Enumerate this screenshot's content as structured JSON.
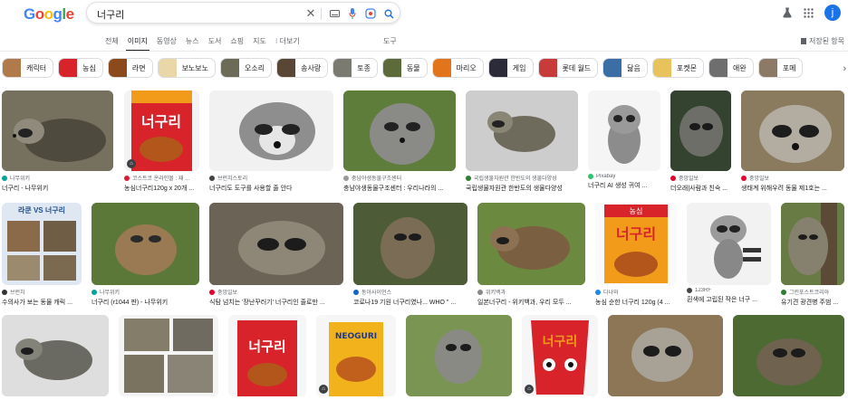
{
  "logo": {
    "text": "Google"
  },
  "search": {
    "query": "너구리"
  },
  "account": {
    "initial": "j"
  },
  "tabs": [
    {
      "label": "전체"
    },
    {
      "label": "이미지"
    },
    {
      "label": "동영상"
    },
    {
      "label": "뉴스"
    },
    {
      "label": "도서"
    },
    {
      "label": "쇼핑"
    },
    {
      "label": "지도"
    },
    {
      "label": "⁝ 더보기"
    }
  ],
  "tools_label": "도구",
  "saved_label": "저장된 항목",
  "chips": [
    {
      "label": "캐릭터"
    },
    {
      "label": "농심"
    },
    {
      "label": "라면"
    },
    {
      "label": "보노보노"
    },
    {
      "label": "오소리"
    },
    {
      "label": "송사랑"
    },
    {
      "label": "토종"
    },
    {
      "label": "동물"
    },
    {
      "label": "마리오"
    },
    {
      "label": "게임"
    },
    {
      "label": "롯데 월드"
    },
    {
      "label": "닮음"
    },
    {
      "label": "포켓몬"
    },
    {
      "label": "애완"
    },
    {
      "label": "포메"
    }
  ],
  "results": [
    {
      "source": "나무위키",
      "title": "너구리 - 나무위키"
    },
    {
      "source": "코스트코 온라인몰 : 재 ...",
      "title": "농심너구리120g x 20개 ..."
    },
    {
      "source": "브런치스토리",
      "title": "너구리도 도구를 사용할 줄 안다"
    },
    {
      "source": "충남야생동물구조센터",
      "title": "충남야생동물구조센터 : 우리나라의 ..."
    },
    {
      "source": "국립생물자원관 한반도의 생물다양성",
      "title": "국립생물자원관 한반도의 생물다양성"
    },
    {
      "source": "Pixabay",
      "title": "너구리 AI 생성 귀여 ..."
    },
    {
      "source": "중앙일보",
      "title": "더오래|사람과 친숙 ..."
    },
    {
      "source": "중앙일보",
      "title": "생태계 위해우려 동물 제1호는 ..."
    },
    {
      "source": "브런치",
      "title": "수의사가 보는 동물 캐릭 ...",
      "banner": "라쿤 VS 너구리"
    },
    {
      "source": "나무위키",
      "title": "너구리 (r1044 판) - 나무위키"
    },
    {
      "source": "중앙일보",
      "title": "식탐 넘치는 '장난꾸러기' 너구리인 줄로만 ..."
    },
    {
      "source": "동아사이언스",
      "title": "코로나19 기원 너구리였나... WHO \" ..."
    },
    {
      "source": "위키백과",
      "title": "일본너구리 - 위키백과, 우리 모두 ..."
    },
    {
      "source": "다나와",
      "title": "농심 순한 너구리 120g (4 ..."
    },
    {
      "source": "123RF",
      "title": "흰색에 고립된 작은 너구 ..."
    },
    {
      "source": "그린포스트코리아",
      "title": "유기견 광견병 주범 ..."
    }
  ],
  "packaging": {
    "brand": "농심",
    "name": "너구리",
    "name_en": "NEOGURI"
  },
  "colors": {
    "accent": "#1a73e8",
    "brand_red": "#d8232a",
    "brand_orange": "#f29b1b"
  }
}
